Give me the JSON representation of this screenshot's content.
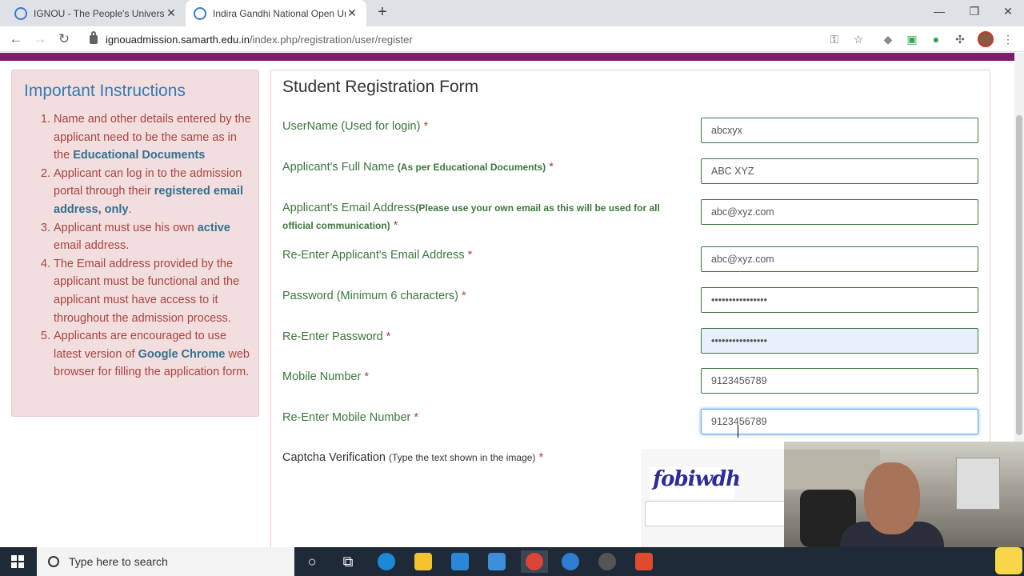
{
  "browser": {
    "tabs": [
      {
        "title": "IGNOU - The People's University"
      },
      {
        "title": "Indira Gandhi National Open Uni"
      }
    ],
    "url_domain": "ignouadmission.samarth.edu.in",
    "url_path": "/index.php/registration/user/register"
  },
  "instructions": {
    "heading": "Important Instructions",
    "items": [
      {
        "pre": "Name and other details entered by the applicant need to be the same as in the ",
        "bold": "Educational Documents",
        "post": ""
      },
      {
        "pre": "Applicant can log in to the admission portal through their ",
        "bold": "registered email address, only",
        "post": "."
      },
      {
        "pre": "Applicant must use his own ",
        "bold": "active",
        "post": " email address."
      },
      {
        "pre": "The Email address provided by the applicant must be functional and the applicant must have access to it throughout the admission process.",
        "bold": "",
        "post": ""
      },
      {
        "pre": "Applicants are encouraged to use latest version of ",
        "bold": "Google Chrome",
        "post": " web browser for filling the application form."
      }
    ]
  },
  "form": {
    "title": "Student Registration Form",
    "fields": [
      {
        "label": "UserName (Used for login)",
        "note": "",
        "value": "abcxyx"
      },
      {
        "label": "Applicant's Full Name",
        "note": "(As per Educational Documents)",
        "value": "ABC XYZ"
      },
      {
        "label": "Applicant's Email Address",
        "note": "(Please use your own email as this will be used for all official communication)",
        "value": "abc@xyz.com"
      },
      {
        "label": "Re-Enter Applicant's Email Address",
        "note": "",
        "value": "abc@xyz.com"
      },
      {
        "label": "Password (Minimum 6 characters)",
        "note": "",
        "value": "••••••••••••••••"
      },
      {
        "label": "Re-Enter Password",
        "note": "",
        "value": "••••••••••••••••"
      },
      {
        "label": "Mobile Number",
        "note": "",
        "value": "9123456789"
      },
      {
        "label": "Re-Enter Mobile Number",
        "note": "",
        "value": "9123456789"
      }
    ],
    "required_mark": "*",
    "captcha_label": "Captcha Verification",
    "captcha_note": "(Type the text shown in the image)",
    "captcha_text": "fobiwdh"
  },
  "taskbar": {
    "search_placeholder": "Type here to search"
  }
}
